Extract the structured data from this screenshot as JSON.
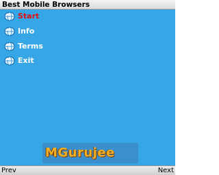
{
  "app": {
    "title": "Best Mobile Browsers"
  },
  "menu": {
    "items": [
      {
        "label": "Start",
        "selected": true,
        "icon": "globe-icon"
      },
      {
        "label": "Info",
        "selected": false,
        "icon": "globe-icon"
      },
      {
        "label": "Terms",
        "selected": false,
        "icon": "globe-icon"
      },
      {
        "label": "Exit",
        "selected": false,
        "icon": "globe-icon"
      }
    ]
  },
  "logo": {
    "text": "MGurujee"
  },
  "softkeys": {
    "left": "Prev",
    "right": "Next"
  },
  "colors": {
    "background": "#37a6e6",
    "selected_text": "#e01010",
    "menu_text": "#ffffff",
    "logo_text": "#f0b028"
  }
}
